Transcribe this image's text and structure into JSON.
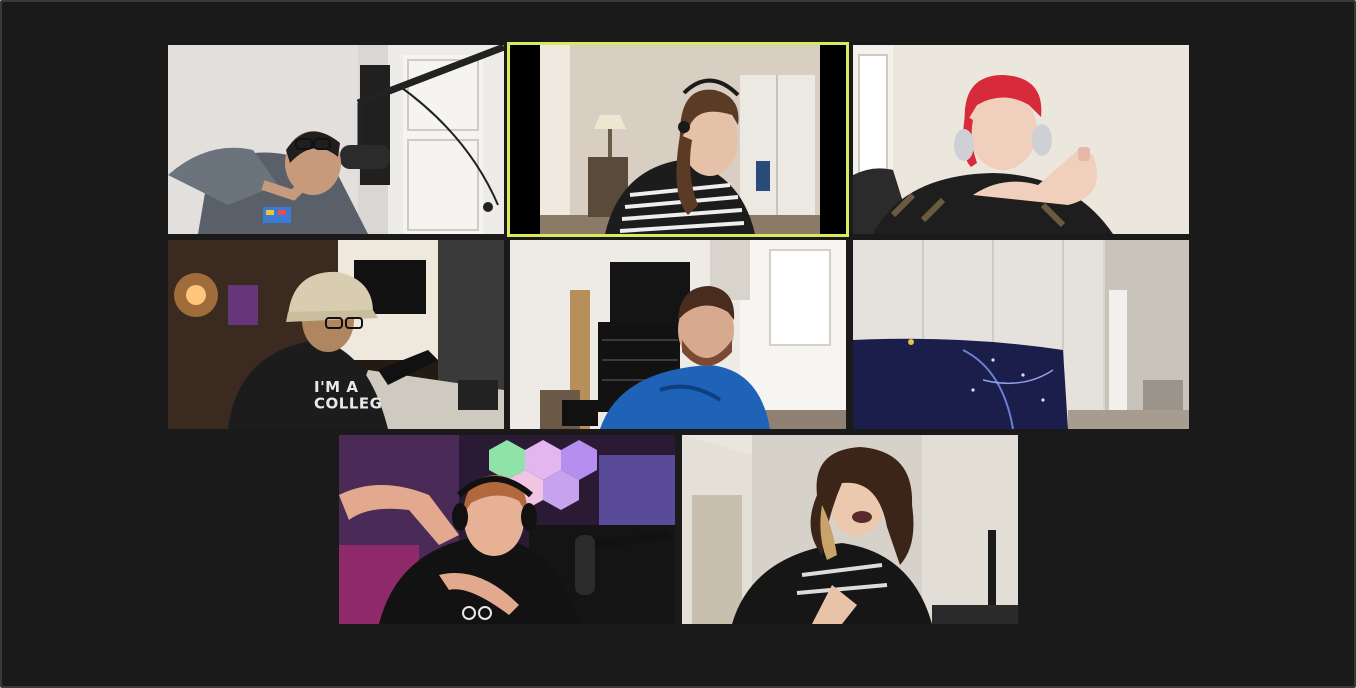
{
  "meeting": {
    "view": "gallery",
    "participant_count": 8,
    "active_speaker_index": 1,
    "colors": {
      "background": "#1a1a1a",
      "active_speaker_border": "#d9ea5c"
    }
  },
  "participants": [
    {
      "tile": "video",
      "shirt_text": ""
    },
    {
      "tile": "video",
      "shirt_text": ""
    },
    {
      "tile": "video",
      "shirt_text": ""
    },
    {
      "tile": "video",
      "shirt_text": "I'M A\nCOLLEG"
    },
    {
      "tile": "video",
      "shirt_text": ""
    },
    {
      "tile": "video",
      "shirt_text": ""
    },
    {
      "tile": "video",
      "shirt_text": ""
    },
    {
      "tile": "video",
      "shirt_text": ""
    }
  ]
}
